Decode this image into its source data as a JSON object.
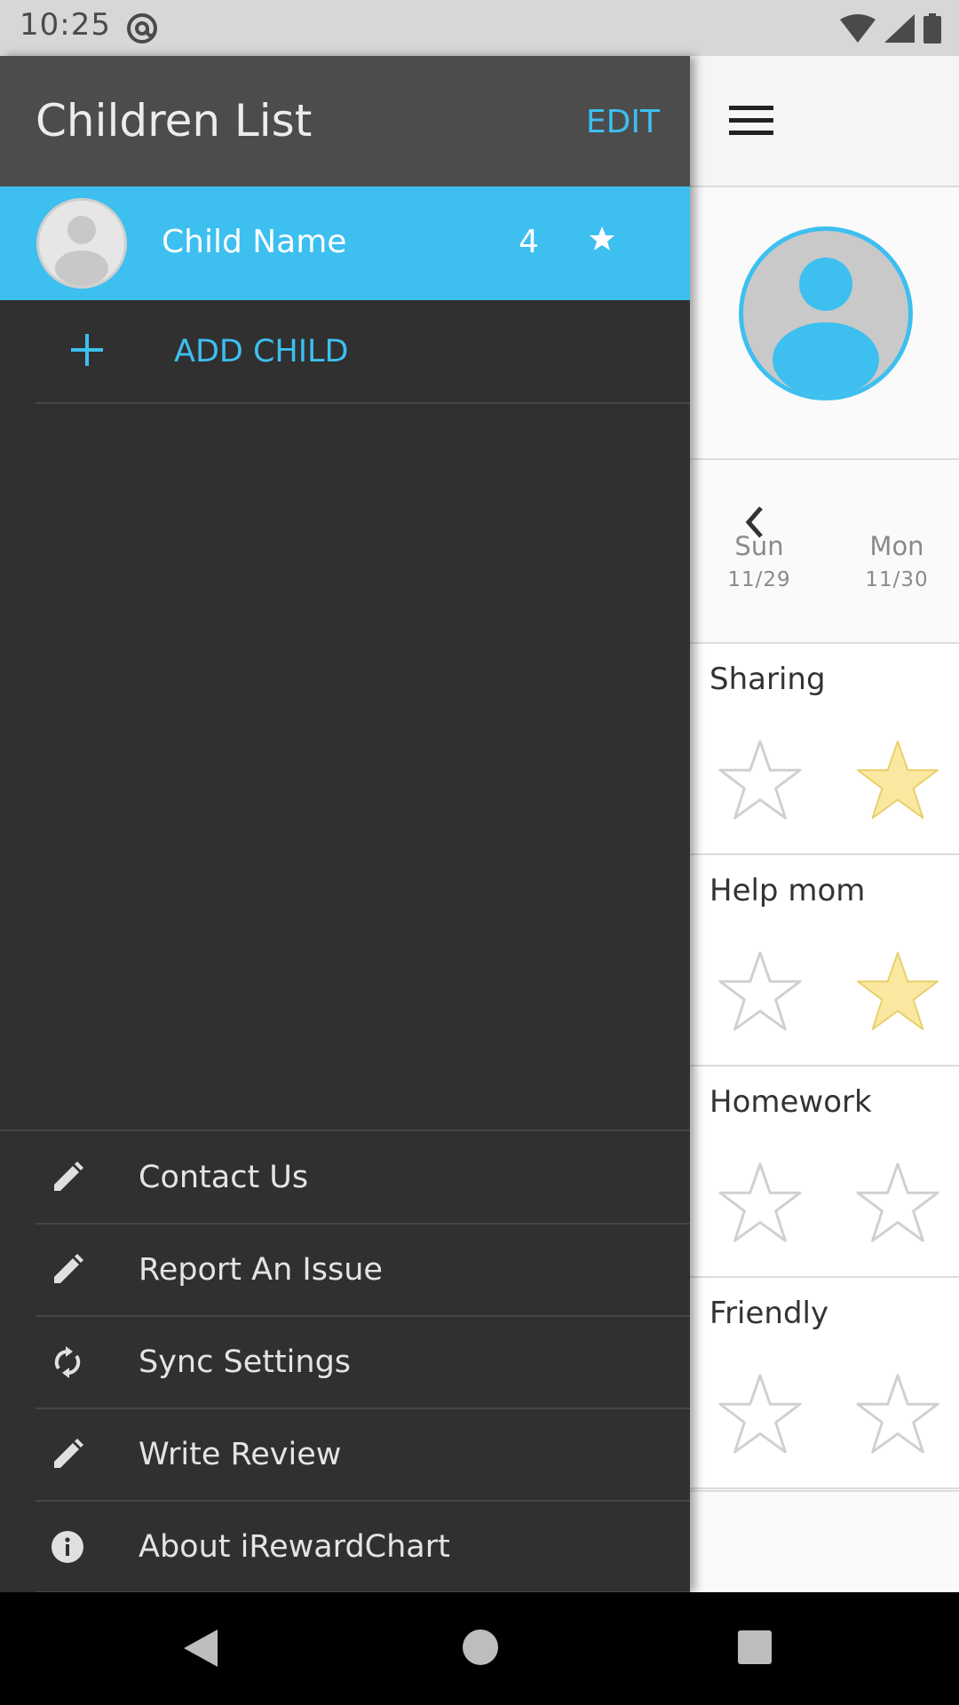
{
  "status_bar": {
    "time": "10:25",
    "icons": [
      "at-sign-icon",
      "wifi-icon",
      "signal-icon",
      "battery-icon"
    ]
  },
  "drawer": {
    "title": "Children List",
    "edit_label": "EDIT",
    "child": {
      "name": "Child Name",
      "count": "4",
      "icon": "star-icon"
    },
    "add_child_label": "ADD CHILD",
    "menu": [
      {
        "label": "Contact Us",
        "icon": "pencil-icon"
      },
      {
        "label": "Report An Issue",
        "icon": "pencil-icon"
      },
      {
        "label": "Sync Settings",
        "icon": "sync-icon"
      },
      {
        "label": "Write Review",
        "icon": "pencil-icon"
      },
      {
        "label": "About iRewardChart",
        "icon": "info-icon"
      }
    ]
  },
  "chart_app": {
    "days": [
      {
        "name": "Sun",
        "date": "11/29"
      },
      {
        "name": "Mon",
        "date": "11/30"
      }
    ],
    "tasks": [
      {
        "name": "Sharing",
        "stars": [
          false,
          true
        ]
      },
      {
        "name": "Help mom",
        "stars": [
          false,
          true
        ]
      },
      {
        "name": "Homework",
        "stars": [
          false,
          false
        ]
      },
      {
        "name": "Friendly",
        "stars": [
          false,
          false
        ]
      }
    ]
  },
  "colors": {
    "accent": "#3dbff0",
    "drawer_bg": "#303030",
    "header_bg": "#4c4c4c",
    "star_filled": "#fbe8a0"
  }
}
